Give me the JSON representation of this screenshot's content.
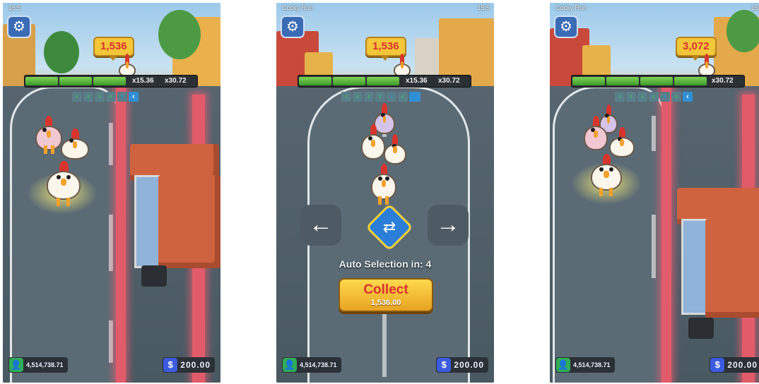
{
  "panels": [
    {
      "status": "16:5",
      "clock": "",
      "score": "1,536",
      "multipliers": [
        "x15.36",
        "x30.72"
      ],
      "balance": "4,514,738.71",
      "cash": "200.00"
    },
    {
      "status": "Cocky Run",
      "clock": "15:5",
      "score": "1,536",
      "multipliers": [
        "x15.36",
        "x30.72"
      ],
      "auto_selection": "Auto Selection in: 4",
      "collect_label": "Collect",
      "collect_amount": "1,536.00",
      "balance": "4,514,738.71",
      "cash": "200.00"
    },
    {
      "status": "Cocky Run",
      "clock": "15:5",
      "score": "3,072",
      "multipliers": [
        "x30.72"
      ],
      "balance": "4,514,738.71",
      "cash": "200.00"
    }
  ],
  "icons": {
    "settings": "gear-icon",
    "balance": "user-wallet-icon",
    "cash": "dollar-icon",
    "left": "arrow-left-icon",
    "right": "arrow-right-icon",
    "shuffle": "shuffle-icon"
  },
  "colors": {
    "accent": "#2c7fd8",
    "score_bg": "#f4c63a",
    "score_text": "#d8322b",
    "progress_green": "#3b9a2a",
    "danger_lane": "#e25b6a"
  }
}
